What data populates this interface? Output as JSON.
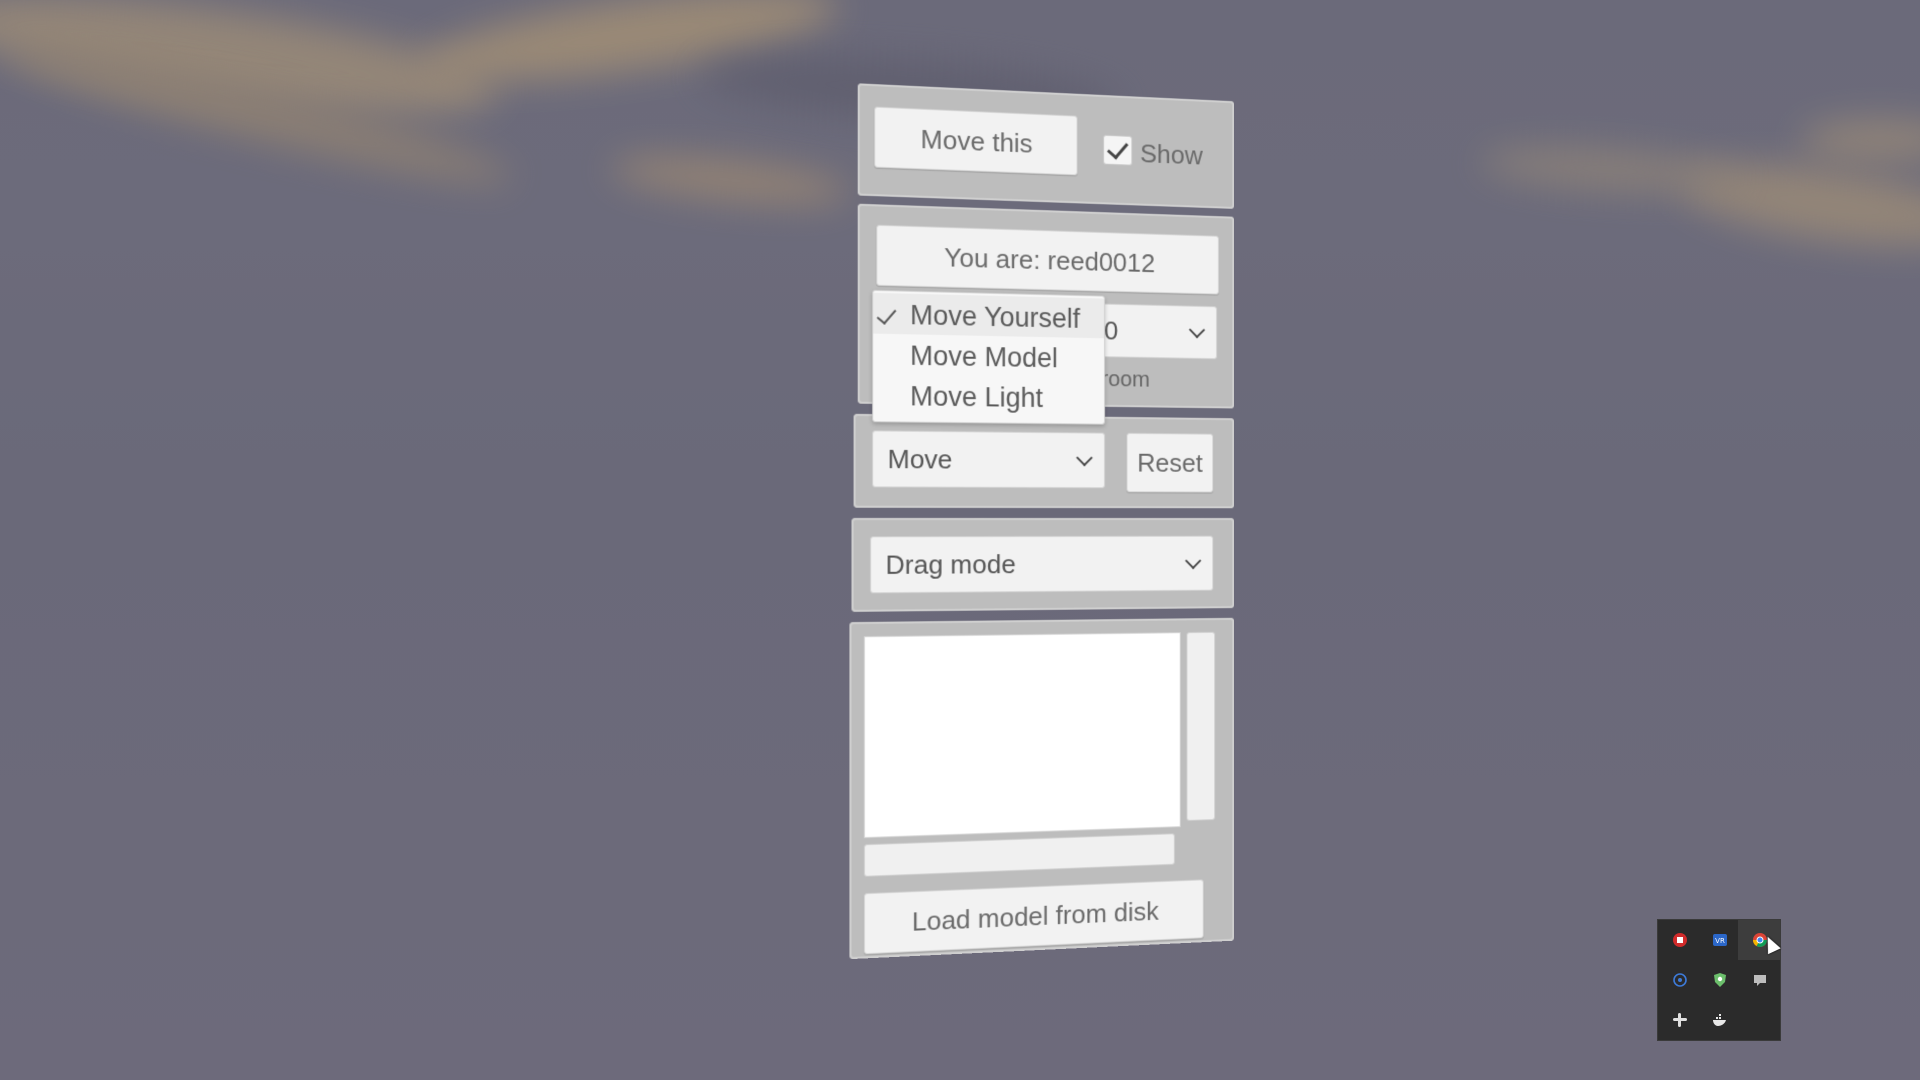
{
  "panel": {
    "move_this_label": "Move this",
    "show_label": "Show",
    "show_checked": true,
    "user_label": "You are: reed0012",
    "room_select_value_partial": "0",
    "room_label_partial": "room",
    "mode_dropdown": {
      "options": [
        "Move Yourself",
        "Move Model",
        "Move Light"
      ],
      "selected": "Move Yourself"
    },
    "move_select_value": "Move",
    "reset_label": "Reset",
    "drag_mode_value": "Drag mode",
    "load_model_label": "Load model from disk"
  },
  "tray": {
    "icons": [
      "red-app-icon",
      "vr-icon",
      "chrome-icon",
      "network-icon",
      "shield-icon",
      "chat-icon",
      "slack-icon",
      "docker-icon"
    ]
  }
}
